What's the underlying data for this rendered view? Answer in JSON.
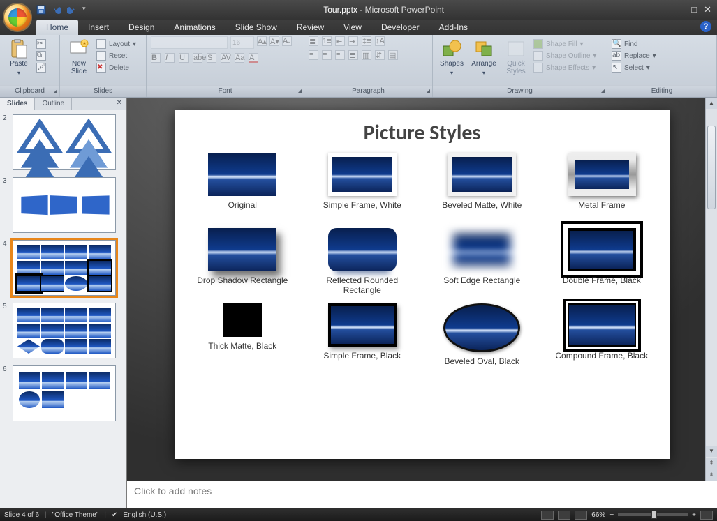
{
  "title": {
    "doc": "Tour.pptx",
    "app": "Microsoft PowerPoint"
  },
  "qat": [
    "save",
    "undo",
    "redo"
  ],
  "tabs": [
    "Home",
    "Insert",
    "Design",
    "Animations",
    "Slide Show",
    "Review",
    "View",
    "Developer",
    "Add-Ins"
  ],
  "active_tab": 0,
  "ribbon": {
    "clipboard": {
      "label": "Clipboard",
      "paste": "Paste",
      "cut": "Cut",
      "copy": "Copy",
      "painter": "Format Painter"
    },
    "slides": {
      "label": "Slides",
      "new": "New\nSlide",
      "layout": "Layout",
      "reset": "Reset",
      "del": "Delete"
    },
    "font": {
      "label": "Font",
      "size": "16"
    },
    "paragraph": {
      "label": "Paragraph"
    },
    "drawing": {
      "label": "Drawing",
      "shapes": "Shapes",
      "arrange": "Arrange",
      "quick": "Quick\nStyles",
      "fill": "Shape Fill",
      "outline": "Shape Outline",
      "effects": "Shape Effects"
    },
    "editing": {
      "label": "Editing",
      "find": "Find",
      "replace": "Replace",
      "select": "Select"
    }
  },
  "panes": {
    "slides_tab": "Slides",
    "outline_tab": "Outline"
  },
  "thumbnails": [
    {
      "n": "2"
    },
    {
      "n": "3"
    },
    {
      "n": "4",
      "selected": true
    },
    {
      "n": "5"
    },
    {
      "n": "6"
    }
  ],
  "slide": {
    "title": "Picture Styles",
    "styles": [
      "Original",
      "Simple Frame, White",
      "Beveled Matte, White",
      "Metal Frame",
      "Drop Shadow Rectangle",
      "Reflected Rounded Rectangle",
      "Soft Edge Rectangle",
      "Double Frame, Black",
      "Thick Matte, Black",
      "Simple Frame, Black",
      "Beveled Oval, Black",
      "Compound Frame, Black"
    ]
  },
  "notes_placeholder": "Click to add notes",
  "status": {
    "slide": "Slide 4 of 6",
    "theme": "\"Office Theme\"",
    "lang": "English (U.S.)",
    "zoom": "66%"
  }
}
